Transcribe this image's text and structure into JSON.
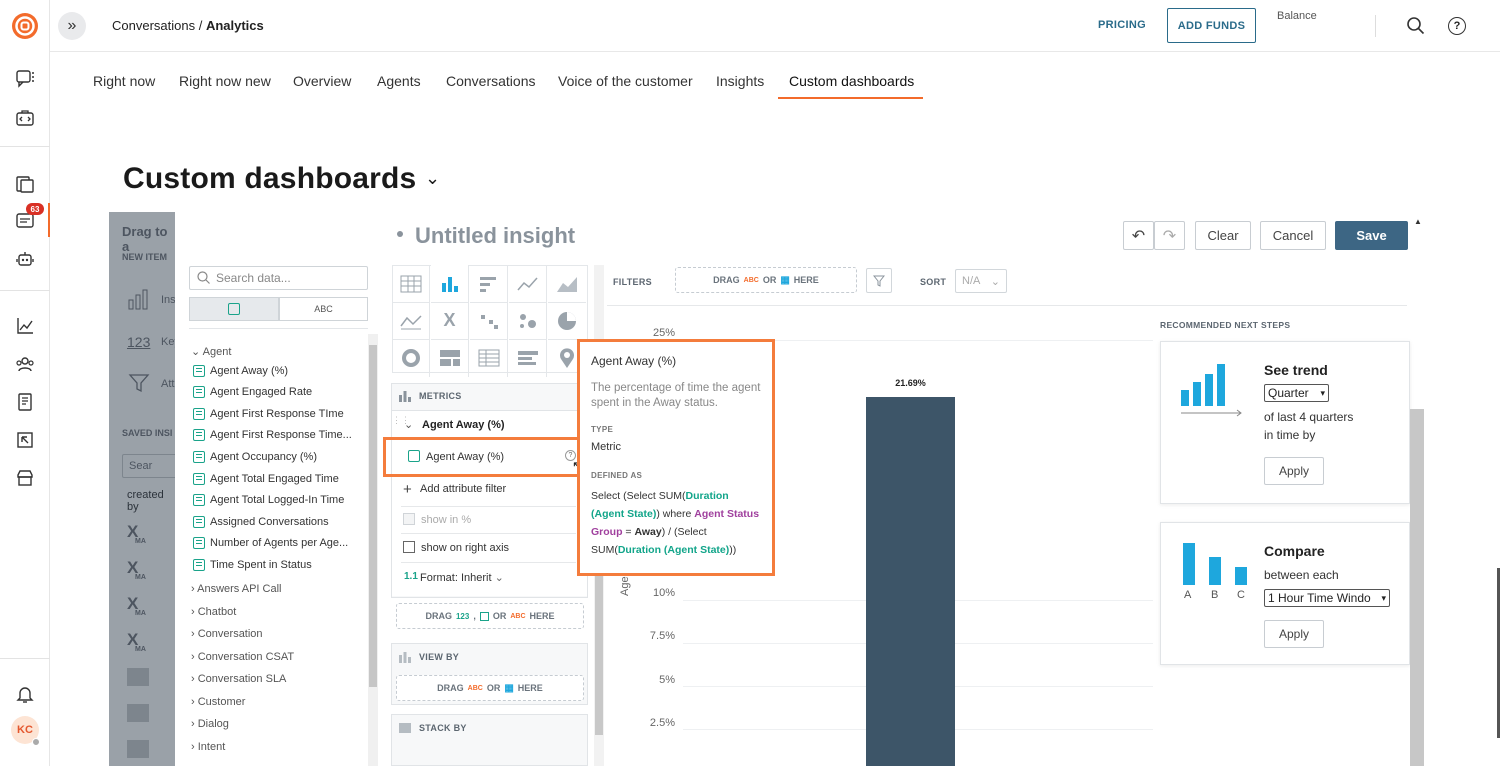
{
  "topbar": {
    "breadcrumb_parent": "Conversations",
    "breadcrumb_sep": " / ",
    "breadcrumb_current": "Analytics",
    "pricing_label": "PRICING",
    "add_funds_label": "ADD FUNDS",
    "balance_label": "Balance"
  },
  "rail": {
    "badge_count": "63",
    "avatar_initials": "KC"
  },
  "tabs": [
    {
      "label": "Right now"
    },
    {
      "label": "Right now new"
    },
    {
      "label": "Overview"
    },
    {
      "label": "Agents"
    },
    {
      "label": "Conversations"
    },
    {
      "label": "Voice of the customer"
    },
    {
      "label": "Insights"
    },
    {
      "label": "Custom dashboards",
      "active": true
    }
  ],
  "page": {
    "title": "Custom dashboards"
  },
  "overlay": {
    "drag_text": "Drag to a",
    "new_item": "NEW ITEM",
    "item1": "Ins",
    "item2": "Key",
    "item2_icon": "123",
    "item3": "Att",
    "saved_insights": "SAVED INSI",
    "search": "Sear",
    "created_by": "created by",
    "row_tag": "MA"
  },
  "editor": {
    "insight_title": "Untitled insight",
    "clear_label": "Clear",
    "cancel_label": "Cancel",
    "save_label": "Save",
    "filters_label": "FILTERS",
    "sort_label": "SORT",
    "sort_value": "N/A",
    "drag_label": "DRAG",
    "or_label": "OR",
    "here_label": "HERE",
    "abc": "ABC",
    "num": "123"
  },
  "datapanel": {
    "search_placeholder": "Search data...",
    "tab_abc": "ABC",
    "group_agent": "Agent",
    "agent_items": [
      "Agent Away (%)",
      "Agent Engaged Rate",
      "Agent First Response TIme",
      "Agent First Response Time...",
      "Agent Occupancy (%)",
      "Agent Total Engaged Time",
      "Agent Total Logged-In Time",
      "Assigned Conversations",
      "Number of Agents per Age...",
      "Time Spent in Status"
    ],
    "groups": [
      "Answers API Call",
      "Chatbot",
      "Conversation",
      "Conversation CSAT",
      "Conversation SLA",
      "Customer",
      "Dialog",
      "Intent"
    ]
  },
  "config": {
    "metrics_label": "METRICS",
    "metric_name": "Agent Away (%)",
    "metric_item": "Agent Away (%)",
    "add_filter": "Add attribute filter",
    "show_in_pct": "show in %",
    "show_right_axis": "show on right axis",
    "format_prefix": "1.1",
    "format_label": "Format: Inherit",
    "view_by_label": "VIEW BY",
    "stack_by_label": "STACK BY"
  },
  "chart_data": {
    "type": "bar",
    "categories": [
      ""
    ],
    "values": [
      21.69
    ],
    "data_labels": [
      "21.69%"
    ],
    "ylabel": "Age",
    "yticks": [
      "2.5%",
      "5%",
      "7.5%",
      "10%",
      "25%"
    ],
    "ylim": [
      0,
      25
    ],
    "grid": true,
    "bar_color": "#3d5568"
  },
  "tooltip": {
    "title": "Agent Away (%)",
    "description": "The percentage of time the agent spent in the Away status.",
    "type_label": "TYPE",
    "type_value": "Metric",
    "defined_label": "DEFINED AS",
    "def_1": "Select (Select SUM(",
    "def_2": "Duration",
    "def_3": "(Agent State)",
    "def_4": ") where ",
    "def_5": "Agent Status",
    "def_6": "Group",
    "def_7": " = ",
    "def_8": "Away",
    "def_9": ") / (Select",
    "def_10": "SUM(",
    "def_11": "Duration (Agent State)",
    "def_12": "))"
  },
  "recommended": {
    "heading": "RECOMMENDED NEXT STEPS",
    "trend_title": "See trend",
    "trend_select": "Quarter",
    "trend_line1": "of last 4 quarters",
    "trend_line2": "in time by",
    "apply": "Apply",
    "compare_title": "Compare",
    "compare_line": "between each",
    "compare_select": "1 Hour Time Windo",
    "abc_a": "A",
    "abc_b": "B",
    "abc_c": "C"
  },
  "colors": {
    "brand": "#f36b2b",
    "primary_button": "#3d6684",
    "teal": "#12a58a",
    "chart_blue": "#1ea7dd"
  }
}
